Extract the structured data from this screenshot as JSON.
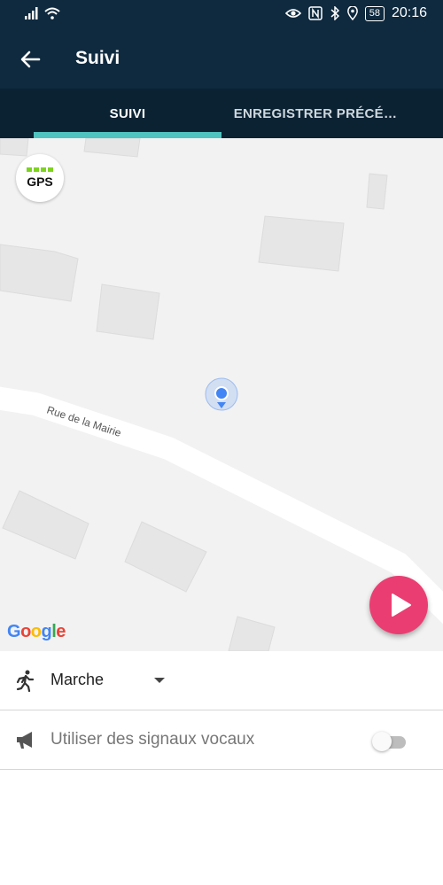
{
  "status_bar": {
    "time": "20:16",
    "battery": "58",
    "icons": [
      "signal-icon",
      "wifi-icon",
      "eye-icon",
      "nfc-icon",
      "bluetooth-icon",
      "location-icon"
    ]
  },
  "app_bar": {
    "title": "Suivi",
    "back_icon": "arrow-left-icon"
  },
  "tabs": [
    {
      "label": "SUIVI",
      "active": true
    },
    {
      "label": "ENREGISTRER PRÉCÉ…",
      "active": false
    }
  ],
  "map": {
    "street_label": "Rue de la Mairie",
    "gps_label": "GPS",
    "gps_signal_bars": 4,
    "attribution": "Google"
  },
  "activity": {
    "icon": "walking-icon",
    "label": "Marche"
  },
  "voice": {
    "icon": "megaphone-icon",
    "label": "Utiliser des signaux vocaux",
    "enabled": false
  },
  "colors": {
    "header": "#0f2a3f",
    "tab_bar": "#0b2233",
    "tab_indicator": "#4fc3c0",
    "play_button": "#ea3e72",
    "gps_green": "#7ed321",
    "location_dot": "#4285f4"
  }
}
